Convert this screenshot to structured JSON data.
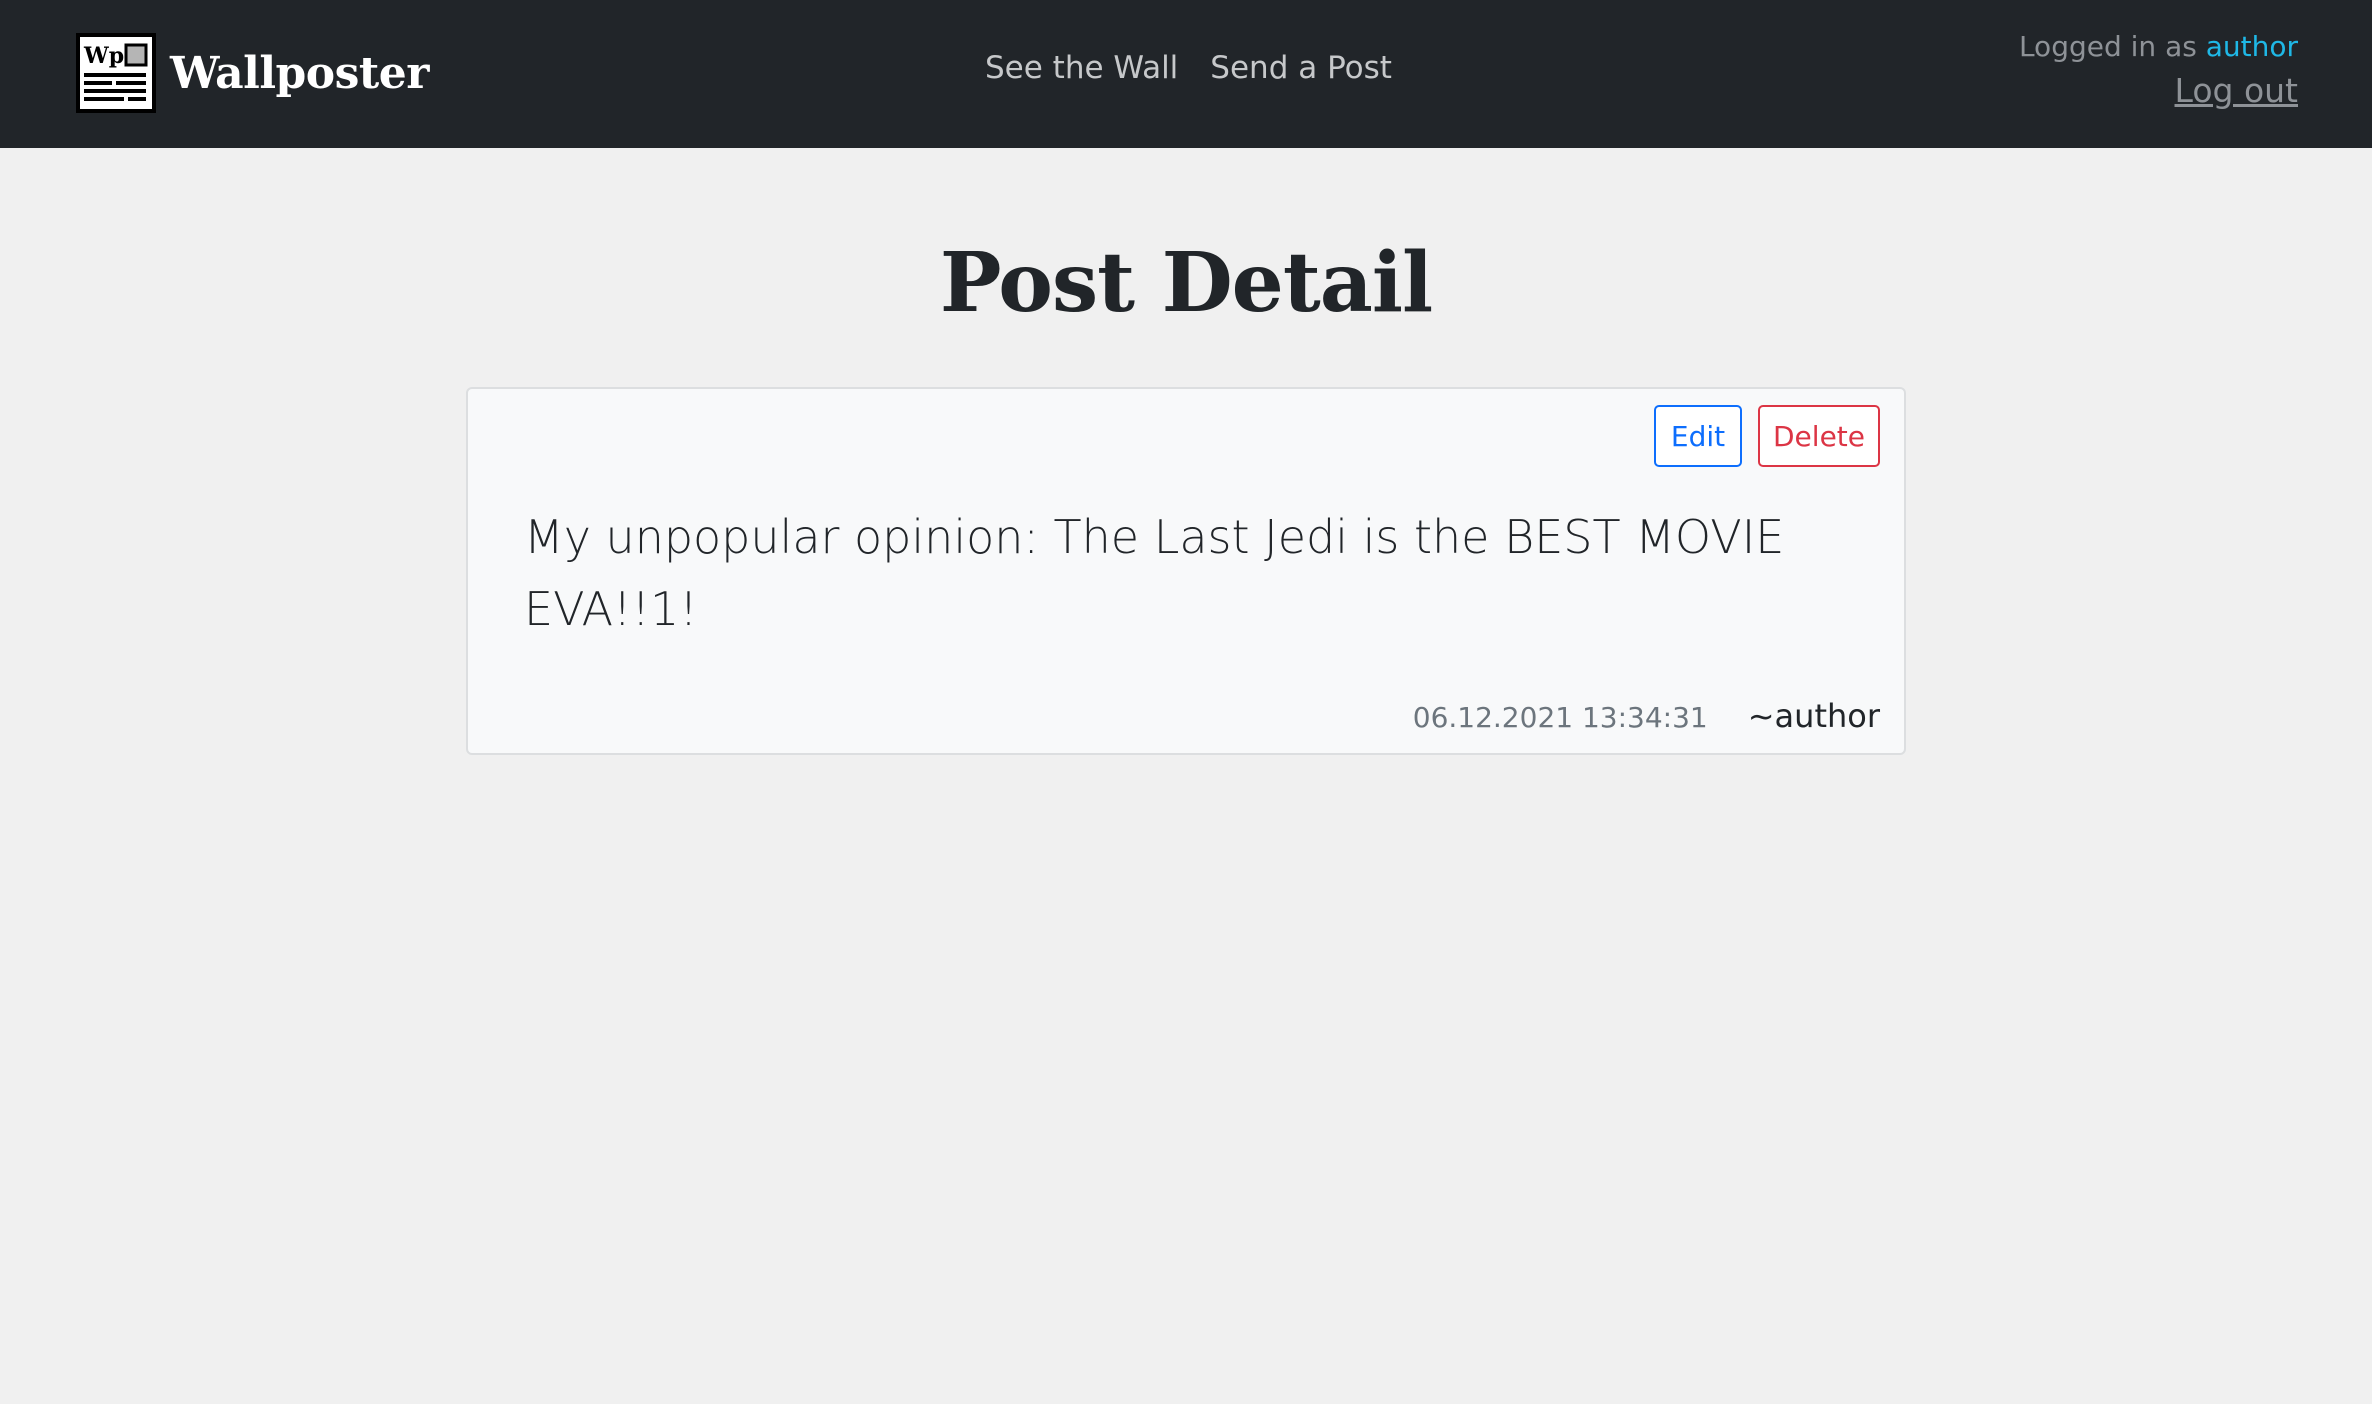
{
  "header": {
    "brand_name": "Wallposter",
    "logo_text": "Wp",
    "nav": [
      {
        "label": "See the Wall"
      },
      {
        "label": "Send a Post"
      }
    ],
    "logged_in_prefix": "Logged in as ",
    "username": "author",
    "logout_label": "Log out"
  },
  "main": {
    "page_title": "Post Detail",
    "post": {
      "edit_label": "Edit",
      "delete_label": "Delete",
      "content": "My unpopular opinion: The Last Jedi is the BEST MOVIE EVA!!1!",
      "timestamp": "06.12.2021 13:34:31",
      "author": "~author"
    }
  },
  "colors": {
    "navbar_bg": "#212529",
    "page_bg": "#f0f0f0",
    "username_accent": "#1fb8e6",
    "edit_button": "#0d6efd",
    "delete_button": "#dc3545"
  }
}
